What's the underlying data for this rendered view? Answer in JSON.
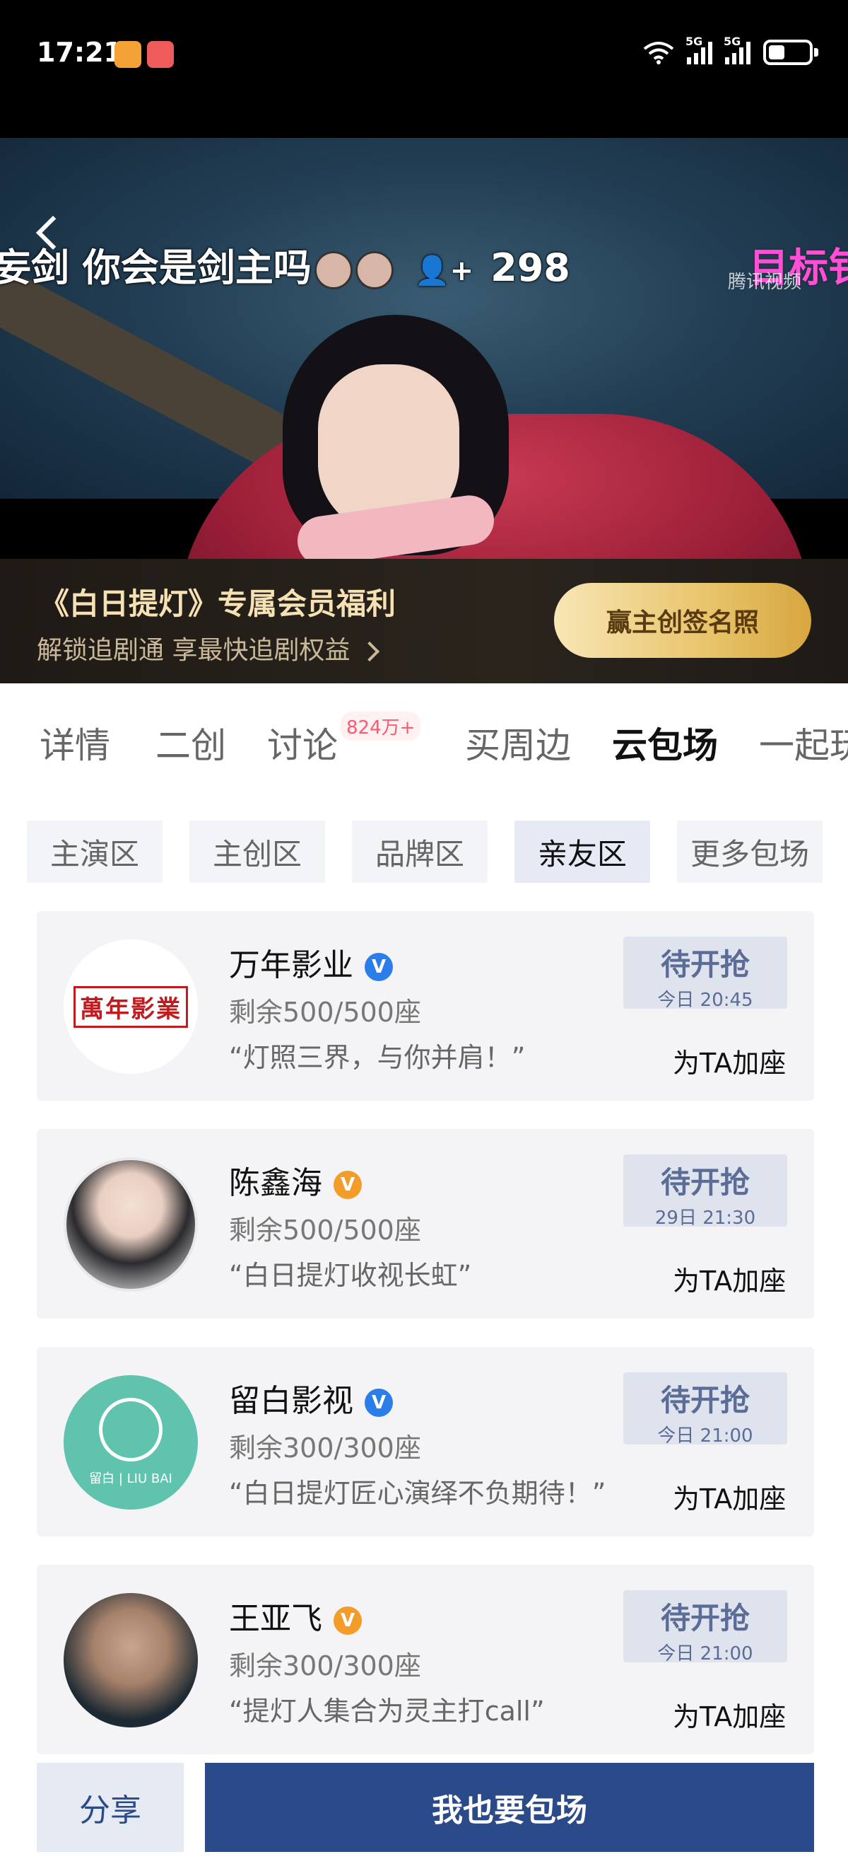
{
  "status_bar": {
    "time": "17:21",
    "network1": "5G",
    "network2": "5G",
    "battery_level": 0.4
  },
  "video": {
    "danmaku_left": "妄剑 你会是剑主吗",
    "viewer_count": "298",
    "danmaku_right": "目标钅",
    "watermark": "腾讯视频"
  },
  "vip_banner": {
    "title": "《白日提灯》专属会员福利",
    "subtitle": "解锁追剧通 享最快追剧权益",
    "cta": "赢主创签名照"
  },
  "tabs": [
    {
      "label": "详情"
    },
    {
      "label": "二创"
    },
    {
      "label": "讨论",
      "badge": "824万+"
    },
    {
      "label": "买周边"
    },
    {
      "label": "云包场"
    },
    {
      "label": "一起玩"
    }
  ],
  "sub_tabs": [
    {
      "label": "主演区"
    },
    {
      "label": "主创区"
    },
    {
      "label": "品牌区"
    },
    {
      "label": "亲友区"
    },
    {
      "label": "更多包场"
    }
  ],
  "cards": [
    {
      "name": "万年影业",
      "badge": "V",
      "badge_color": "#2b7de9",
      "seats": "剩余500/500座",
      "quote": "“灯照三界，与你并肩！”",
      "status": "待开抢",
      "time": "今日 20:45",
      "action": "为TA加座",
      "logo_text": "萬年影業"
    },
    {
      "name": "陈鑫海",
      "badge": "V",
      "badge_color": "#f39c2a",
      "seats": "剩余500/500座",
      "quote": "“白日提灯收视长虹”",
      "status": "待开抢",
      "time": "29日 21:30",
      "action": "为TA加座"
    },
    {
      "name": "留白影视",
      "badge": "V",
      "badge_color": "#2b7de9",
      "seats": "剩余300/300座",
      "quote": "“白日提灯匠心演绎不负期待！”",
      "status": "待开抢",
      "time": "今日 21:00",
      "action": "为TA加座",
      "logo_text": "留白 | LIU BAI"
    },
    {
      "name": "王亚飞",
      "badge": "V",
      "badge_color": "#f39c2a",
      "seats": "剩余300/300座",
      "quote": "“提灯人集合为灵主打call”",
      "status": "待开抢",
      "time": "今日 21:00",
      "action": "为TA加座"
    }
  ],
  "bottom_bar": {
    "share": "分享",
    "book": "我也要包场"
  }
}
